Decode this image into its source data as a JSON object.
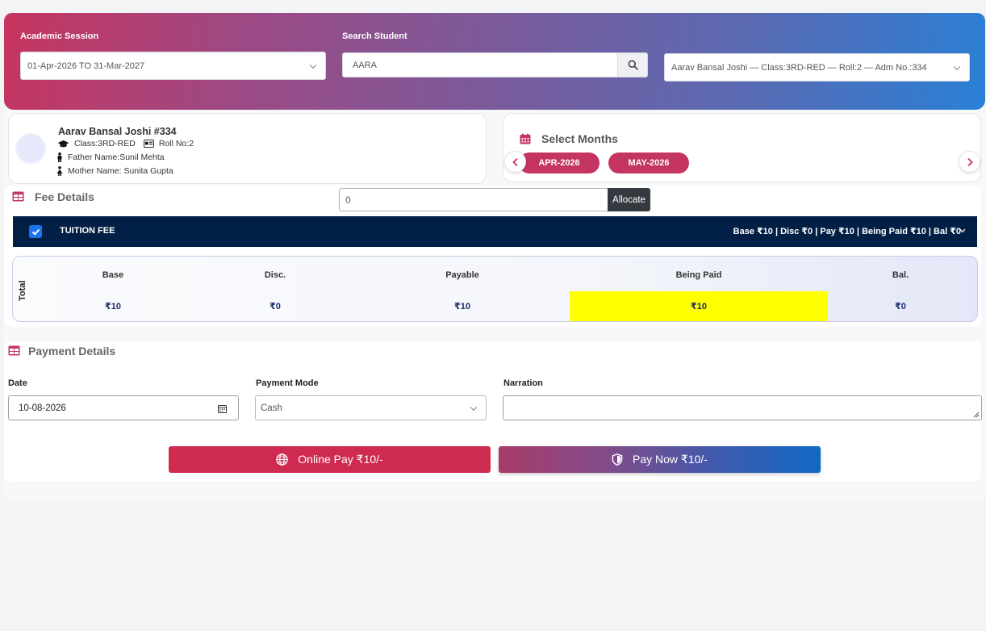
{
  "header": {
    "session_label": "Academic Session",
    "session_value": "01-Apr-2026 TO 31-Mar-2027",
    "search_label": "Search Student",
    "search_value": "AARA",
    "student_select_value": "Aarav Bansal Joshi — Class:3RD-RED — Roll:2 — Adm No.:334"
  },
  "student": {
    "name": "Aarav Bansal Joshi #334",
    "class_text": "Class:3RD-RED",
    "roll_text": "Roll No:2",
    "father_text": "Father Name:Sunil Mehta",
    "mother_text": "Mother Name: Sunita Gupta"
  },
  "months": {
    "title": "Select Months",
    "items": [
      "APR-2026",
      "MAY-2026"
    ]
  },
  "fee": {
    "title": "Fee Details",
    "allocate_value": "0",
    "allocate_label": "Allocate",
    "bar_title": "TUITION FEE",
    "bar_summary": "Base ₹10 | Disc ₹0 | Pay ₹10 | Being Paid ₹10 | Bal ₹0",
    "total_label": "Total",
    "columns": [
      {
        "header": "Base",
        "value": "₹10"
      },
      {
        "header": "Disc.",
        "value": "₹0"
      },
      {
        "header": "Payable",
        "value": "₹10"
      },
      {
        "header": "Being Paid",
        "value": "₹10"
      },
      {
        "header": "Bal.",
        "value": "₹0"
      }
    ]
  },
  "payment": {
    "title": "Payment Details",
    "date_label": "Date",
    "date_value": "10-08-2026",
    "mode_label": "Payment Mode",
    "mode_value": "Cash",
    "narration_label": "Narration",
    "narration_value": "",
    "online_btn": "Online Pay ₹10/-",
    "paynow_btn": "Pay Now ₹10/-"
  },
  "colors": {
    "accent": "#c43561",
    "navy": "#022045",
    "highlight": "#ffff00"
  }
}
